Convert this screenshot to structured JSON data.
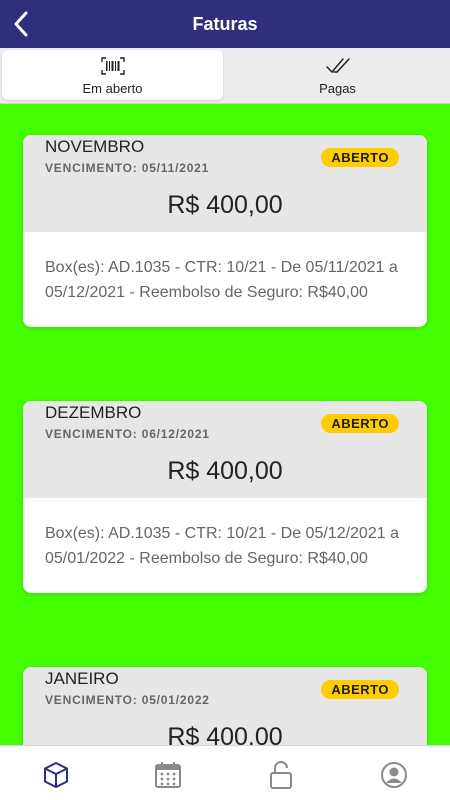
{
  "header": {
    "title": "Faturas"
  },
  "tabs": [
    {
      "label": "Em aberto",
      "icon": "barcode-icon"
    },
    {
      "label": "Pagas",
      "icon": "double-check-icon"
    }
  ],
  "invoices": [
    {
      "month": "NOVEMBRO",
      "due": "VENCIMENTO: 05/11/2021",
      "status": "ABERTO",
      "amount": "R$ 400,00",
      "description": "Box(es): AD.1035 - CTR: 10/21 - De 05/11/2021 a 05/12/2021 - Reembolso de Seguro: R$40,00"
    },
    {
      "month": "DEZEMBRO",
      "due": "VENCIMENTO: 06/12/2021",
      "status": "ABERTO",
      "amount": "R$ 400,00",
      "description": "Box(es): AD.1035 - CTR: 10/21 - De 05/12/2021 a 05/01/2022 - Reembolso de Seguro: R$40,00"
    },
    {
      "month": "JANEIRO",
      "due": "VENCIMENTO: 05/01/2022",
      "status": "ABERTO",
      "amount": "R$ 400,00",
      "description": ""
    }
  ],
  "bottom_nav": [
    {
      "icon": "box-icon",
      "active": true
    },
    {
      "icon": "calendar-icon",
      "active": false
    },
    {
      "icon": "unlock-icon",
      "active": false
    },
    {
      "icon": "user-icon",
      "active": false
    }
  ],
  "colors": {
    "header": "#2e2f7d",
    "background": "#44ff00",
    "badge": "#ffcc00",
    "nav_active": "#2e2f7d",
    "nav_inactive": "#8a8a8a"
  }
}
